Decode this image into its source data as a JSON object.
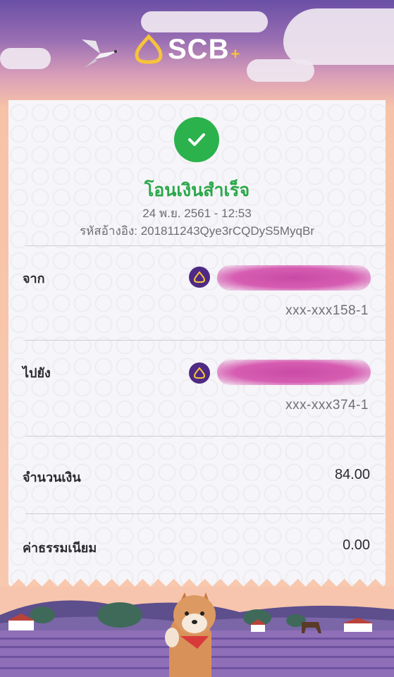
{
  "header": {
    "brand": "SCB",
    "brand_plus": "+"
  },
  "receipt": {
    "status_title": "โอนเงินสำเร็จ",
    "datetime": "24 พ.ย. 2561 - 12:53",
    "reference": "รหัสอ้างอิง: 201811243Qye3rCQDyS5MyqBr",
    "from": {
      "label": "จาก",
      "account": "xxx-xxx158-1"
    },
    "to": {
      "label": "ไปยัง",
      "account": "xxx-xxx374-1"
    },
    "amount": {
      "label": "จำนวนเงิน",
      "value": "84.00"
    },
    "fee": {
      "label": "ค่าธรรมเนียม",
      "value": "0.00"
    }
  },
  "colors": {
    "success_green": "#2bb24c",
    "scb_purple": "#4e2a84",
    "scb_gold": "#f6c33c"
  }
}
